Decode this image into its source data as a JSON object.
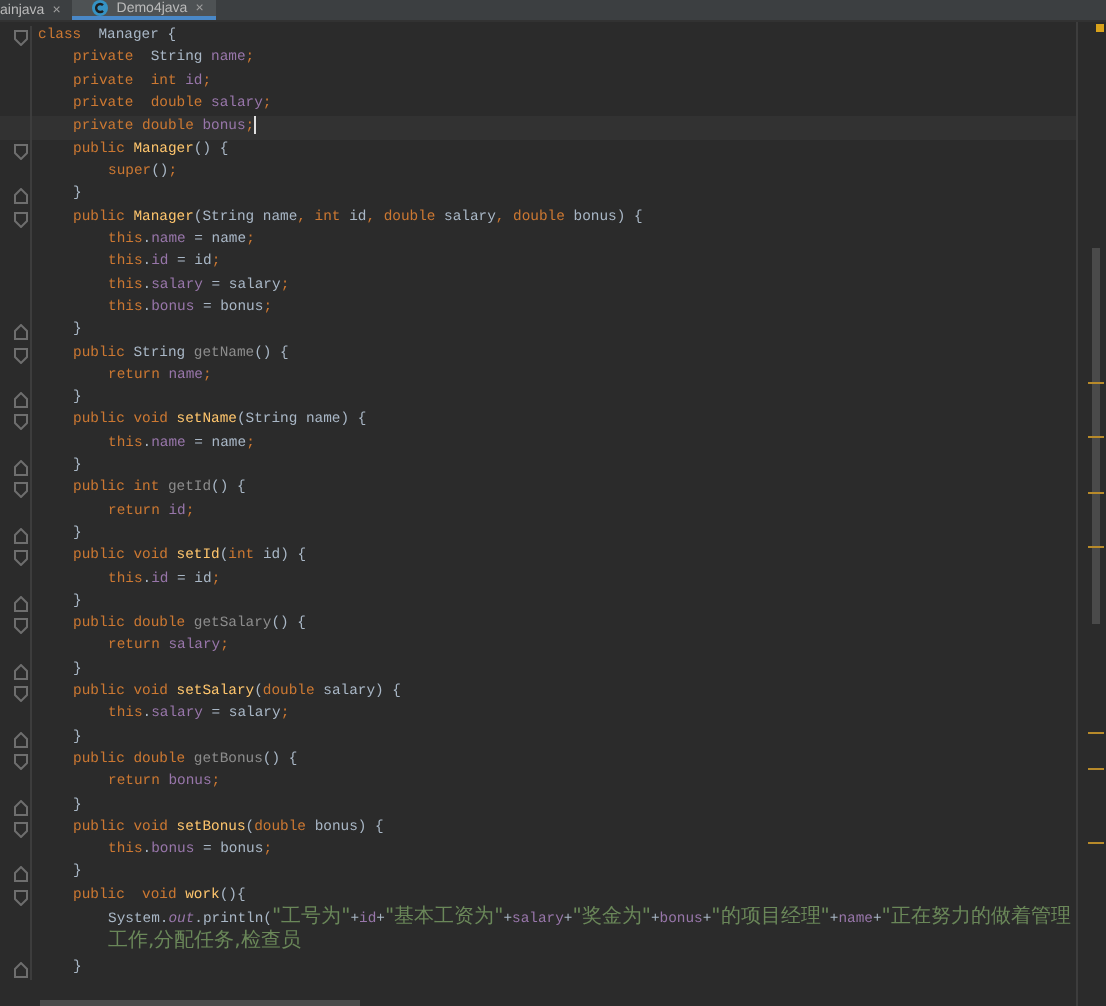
{
  "tabs": [
    {
      "label": "ainjava",
      "close": "×",
      "selected": false
    },
    {
      "label": "Demo4java",
      "close": "×",
      "selected": true
    }
  ],
  "code": [
    {
      "current": false,
      "tokens": [
        {
          "kind": "keyword",
          "text": "class"
        },
        {
          "kind": "plain",
          "text": "  Manager {"
        }
      ],
      "children": [
        {
          "current": false,
          "tokens": [
            {
              "kind": "keyword",
              "text": "private  "
            },
            {
              "kind": "plain",
              "text": "String "
            },
            {
              "kind": "field",
              "text": "name"
            },
            {
              "kind": "keyword",
              "text": ";"
            }
          ]
        },
        {
          "current": false,
          "tokens": [
            {
              "kind": "keyword",
              "text": "private  int "
            },
            {
              "kind": "field",
              "text": "id"
            },
            {
              "kind": "keyword",
              "text": ";"
            }
          ]
        },
        {
          "current": false,
          "tokens": [
            {
              "kind": "keyword",
              "text": "private  double "
            },
            {
              "kind": "field",
              "text": "salary"
            },
            {
              "kind": "keyword",
              "text": ";"
            }
          ]
        },
        {
          "current": true,
          "tokens": [
            {
              "kind": "keyword",
              "text": "private double "
            },
            {
              "kind": "field",
              "text": "bonus"
            },
            {
              "kind": "keyword",
              "text": ";"
            }
          ]
        },
        {
          "current": false,
          "tokens": [
            {
              "kind": "keyword",
              "text": "public "
            },
            {
              "kind": "method",
              "text": "Manager"
            },
            {
              "kind": "plain",
              "text": "() {"
            }
          ],
          "end": "}",
          "children": [
            {
              "current": false,
              "tokens": [
                {
                  "kind": "keyword",
                  "text": "super"
                },
                {
                  "kind": "plain",
                  "text": "()"
                },
                {
                  "kind": "keyword",
                  "text": ";"
                }
              ]
            }
          ]
        },
        {
          "current": false,
          "tokens": [
            {
              "kind": "keyword",
              "text": "public "
            },
            {
              "kind": "method",
              "text": "Manager"
            },
            {
              "kind": "plain",
              "text": "(String name"
            },
            {
              "kind": "keyword",
              "text": ", int "
            },
            {
              "kind": "plain",
              "text": "id"
            },
            {
              "kind": "keyword",
              "text": ", double "
            },
            {
              "kind": "plain",
              "text": "salary"
            },
            {
              "kind": "keyword",
              "text": ", double "
            },
            {
              "kind": "plain",
              "text": "bonus) {"
            }
          ],
          "end": "}",
          "children": [
            {
              "current": false,
              "tokens": [
                {
                  "kind": "keyword",
                  "text": "this"
                },
                {
                  "kind": "plain",
                  "text": "."
                },
                {
                  "kind": "field",
                  "text": "name"
                },
                {
                  "kind": "plain",
                  "text": " = name"
                },
                {
                  "kind": "keyword",
                  "text": ";"
                }
              ]
            },
            {
              "current": false,
              "tokens": [
                {
                  "kind": "keyword",
                  "text": "this"
                },
                {
                  "kind": "plain",
                  "text": "."
                },
                {
                  "kind": "field",
                  "text": "id"
                },
                {
                  "kind": "plain",
                  "text": " = id"
                },
                {
                  "kind": "keyword",
                  "text": ";"
                }
              ]
            },
            {
              "current": false,
              "tokens": [
                {
                  "kind": "keyword",
                  "text": "this"
                },
                {
                  "kind": "plain",
                  "text": "."
                },
                {
                  "kind": "field",
                  "text": "salary"
                },
                {
                  "kind": "plain",
                  "text": " = salary"
                },
                {
                  "kind": "keyword",
                  "text": ";"
                }
              ]
            },
            {
              "current": false,
              "tokens": [
                {
                  "kind": "keyword",
                  "text": "this"
                },
                {
                  "kind": "plain",
                  "text": "."
                },
                {
                  "kind": "field",
                  "text": "bonus"
                },
                {
                  "kind": "plain",
                  "text": " = bonus"
                },
                {
                  "kind": "keyword",
                  "text": ";"
                }
              ]
            }
          ]
        },
        {
          "current": false,
          "tokens": [
            {
              "kind": "keyword",
              "text": "public "
            },
            {
              "kind": "plain",
              "text": "String "
            },
            {
              "kind": "unused",
              "text": "getName"
            },
            {
              "kind": "plain",
              "text": "() {"
            }
          ],
          "end": "}",
          "children": [
            {
              "current": false,
              "tokens": [
                {
                  "kind": "keyword",
                  "text": "return "
                },
                {
                  "kind": "field",
                  "text": "name"
                },
                {
                  "kind": "keyword",
                  "text": ";"
                }
              ]
            }
          ]
        },
        {
          "current": false,
          "tokens": [
            {
              "kind": "keyword",
              "text": "public void "
            },
            {
              "kind": "method",
              "text": "setName"
            },
            {
              "kind": "plain",
              "text": "(String name) {"
            }
          ],
          "end": "}",
          "children": [
            {
              "current": false,
              "tokens": [
                {
                  "kind": "keyword",
                  "text": "this"
                },
                {
                  "kind": "plain",
                  "text": "."
                },
                {
                  "kind": "field",
                  "text": "name"
                },
                {
                  "kind": "plain",
                  "text": " = name"
                },
                {
                  "kind": "keyword",
                  "text": ";"
                }
              ]
            }
          ]
        },
        {
          "current": false,
          "tokens": [
            {
              "kind": "keyword",
              "text": "public int "
            },
            {
              "kind": "unused",
              "text": "getId"
            },
            {
              "kind": "plain",
              "text": "() {"
            }
          ],
          "end": "}",
          "children": [
            {
              "current": false,
              "tokens": [
                {
                  "kind": "keyword",
                  "text": "return "
                },
                {
                  "kind": "field",
                  "text": "id"
                },
                {
                  "kind": "keyword",
                  "text": ";"
                }
              ]
            }
          ]
        },
        {
          "current": false,
          "tokens": [
            {
              "kind": "keyword",
              "text": "public void "
            },
            {
              "kind": "method",
              "text": "setId"
            },
            {
              "kind": "plain",
              "text": "("
            },
            {
              "kind": "keyword",
              "text": "int "
            },
            {
              "kind": "plain",
              "text": "id) {"
            }
          ],
          "end": "}",
          "children": [
            {
              "current": false,
              "tokens": [
                {
                  "kind": "keyword",
                  "text": "this"
                },
                {
                  "kind": "plain",
                  "text": "."
                },
                {
                  "kind": "field",
                  "text": "id"
                },
                {
                  "kind": "plain",
                  "text": " = id"
                },
                {
                  "kind": "keyword",
                  "text": ";"
                }
              ]
            }
          ]
        },
        {
          "current": false,
          "tokens": [
            {
              "kind": "keyword",
              "text": "public double "
            },
            {
              "kind": "unused",
              "text": "getSalary"
            },
            {
              "kind": "plain",
              "text": "() {"
            }
          ],
          "end": "}",
          "children": [
            {
              "current": false,
              "tokens": [
                {
                  "kind": "keyword",
                  "text": "return "
                },
                {
                  "kind": "field",
                  "text": "salary"
                },
                {
                  "kind": "keyword",
                  "text": ";"
                }
              ]
            }
          ]
        },
        {
          "current": false,
          "tokens": [
            {
              "kind": "keyword",
              "text": "public void "
            },
            {
              "kind": "method",
              "text": "setSalary"
            },
            {
              "kind": "plain",
              "text": "("
            },
            {
              "kind": "keyword",
              "text": "double "
            },
            {
              "kind": "plain",
              "text": "salary) {"
            }
          ],
          "end": "}",
          "children": [
            {
              "current": false,
              "tokens": [
                {
                  "kind": "keyword",
                  "text": "this"
                },
                {
                  "kind": "plain",
                  "text": "."
                },
                {
                  "kind": "field",
                  "text": "salary"
                },
                {
                  "kind": "plain",
                  "text": " = salary"
                },
                {
                  "kind": "keyword",
                  "text": ";"
                }
              ]
            }
          ]
        },
        {
          "current": false,
          "tokens": [
            {
              "kind": "keyword",
              "text": "public double "
            },
            {
              "kind": "unused",
              "text": "getBonus"
            },
            {
              "kind": "plain",
              "text": "() {"
            }
          ],
          "end": "}",
          "children": [
            {
              "current": false,
              "tokens": [
                {
                  "kind": "keyword",
                  "text": "return "
                },
                {
                  "kind": "field",
                  "text": "bonus"
                },
                {
                  "kind": "keyword",
                  "text": ";"
                }
              ]
            }
          ]
        },
        {
          "current": false,
          "tokens": [
            {
              "kind": "keyword",
              "text": "public void "
            },
            {
              "kind": "method",
              "text": "setBonus"
            },
            {
              "kind": "plain",
              "text": "("
            },
            {
              "kind": "keyword",
              "text": "double "
            },
            {
              "kind": "plain",
              "text": "bonus) {"
            }
          ],
          "end": "}",
          "children": [
            {
              "current": false,
              "tokens": [
                {
                  "kind": "keyword",
                  "text": "this"
                },
                {
                  "kind": "plain",
                  "text": "."
                },
                {
                  "kind": "field",
                  "text": "bonus"
                },
                {
                  "kind": "plain",
                  "text": " = bonus"
                },
                {
                  "kind": "keyword",
                  "text": ";"
                }
              ]
            }
          ]
        },
        {
          "current": false,
          "tokens": [
            {
              "kind": "keyword",
              "text": "public  void "
            },
            {
              "kind": "method",
              "text": "work"
            },
            {
              "kind": "plain",
              "text": "(){"
            }
          ],
          "end": "}",
          "children": [
            {
              "current": false,
              "tokens": [
                {
                  "kind": "plain",
                  "text": "System."
                },
                {
                  "kind": "static",
                  "text": "out"
                },
                {
                  "kind": "plain",
                  "text": ".println("
                },
                {
                  "kind": "string",
                  "text": "\"工号为\""
                },
                {
                  "kind": "plain",
                  "text": "+"
                },
                {
                  "kind": "field",
                  "text": "id"
                },
                {
                  "kind": "plain",
                  "text": "+"
                },
                {
                  "kind": "string",
                  "text": "\"基本工资为\""
                },
                {
                  "kind": "plain",
                  "text": "+"
                },
                {
                  "kind": "field",
                  "text": "salary"
                },
                {
                  "kind": "plain",
                  "text": "+"
                },
                {
                  "kind": "string",
                  "text": "\"奖金为\""
                },
                {
                  "kind": "plain",
                  "text": "+"
                },
                {
                  "kind": "field",
                  "text": "bonus"
                },
                {
                  "kind": "plain",
                  "text": "+"
                },
                {
                  "kind": "string",
                  "text": "\"的项目经理\""
                },
                {
                  "kind": "plain",
                  "text": "+"
                },
                {
                  "kind": "field",
                  "text": "name"
                },
                {
                  "kind": "plain",
                  "text": "+"
                },
                {
                  "kind": "string",
                  "text": "\"正在努力的做着管理工作,分配任务,检查员"
                }
              ]
            }
          ]
        }
      ]
    }
  ]
}
